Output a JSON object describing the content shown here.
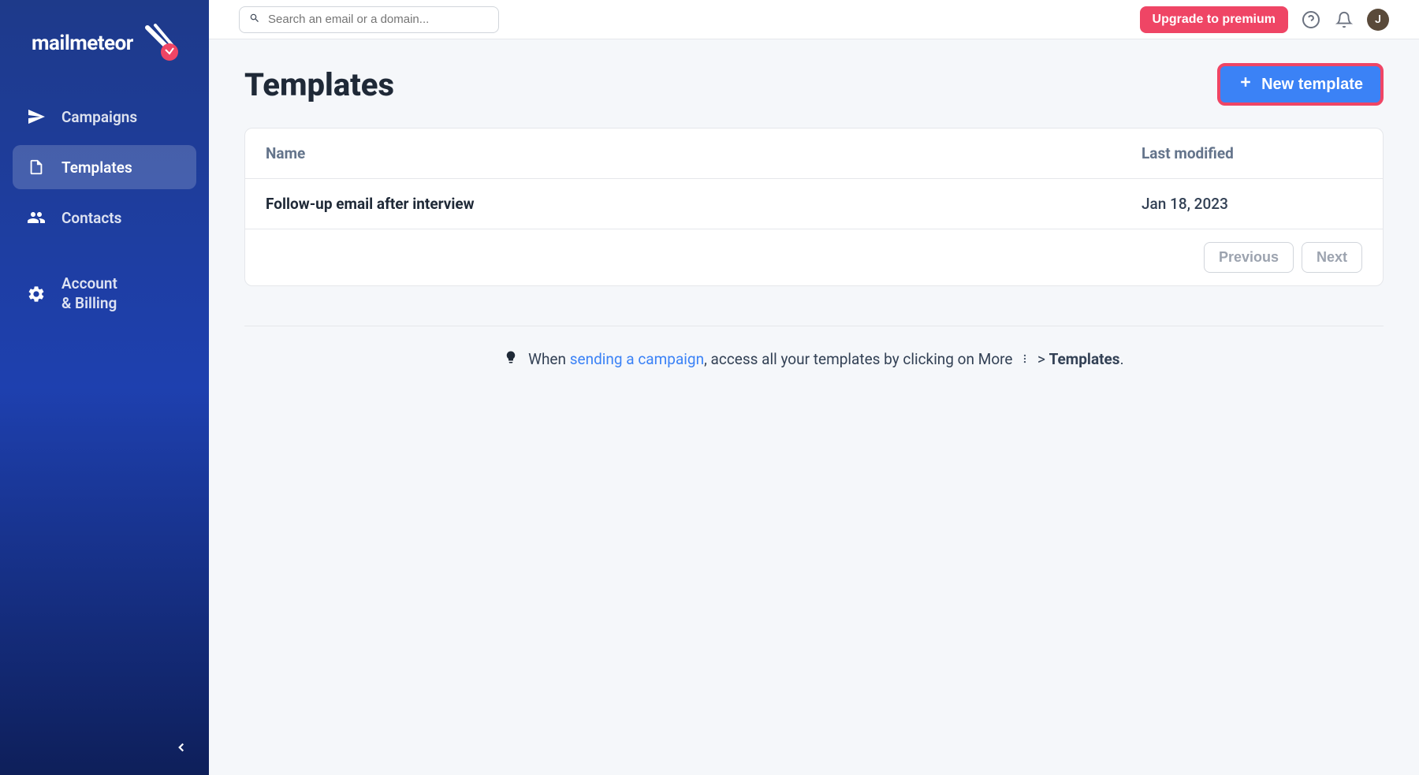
{
  "brand": {
    "name": "mailmeteor"
  },
  "sidebar": {
    "items": [
      {
        "label": "Campaigns"
      },
      {
        "label": "Templates"
      },
      {
        "label": "Contacts"
      },
      {
        "label": "Account\n& Billing"
      }
    ]
  },
  "topbar": {
    "search_placeholder": "Search an email or a domain...",
    "upgrade_label": "Upgrade to premium",
    "avatar_initial": "J"
  },
  "page": {
    "title": "Templates",
    "new_button_label": "New template"
  },
  "table": {
    "headers": {
      "name": "Name",
      "modified": "Last modified"
    },
    "rows": [
      {
        "name": "Follow-up email after interview",
        "modified": "Jan 18, 2023"
      }
    ],
    "pager": {
      "prev": "Previous",
      "next": "Next"
    }
  },
  "hint": {
    "prefix": "When ",
    "link": "sending a campaign",
    "mid": ", access all your templates by clicking on More",
    "chevron": ">",
    "target": "Templates",
    "suffix": "."
  }
}
